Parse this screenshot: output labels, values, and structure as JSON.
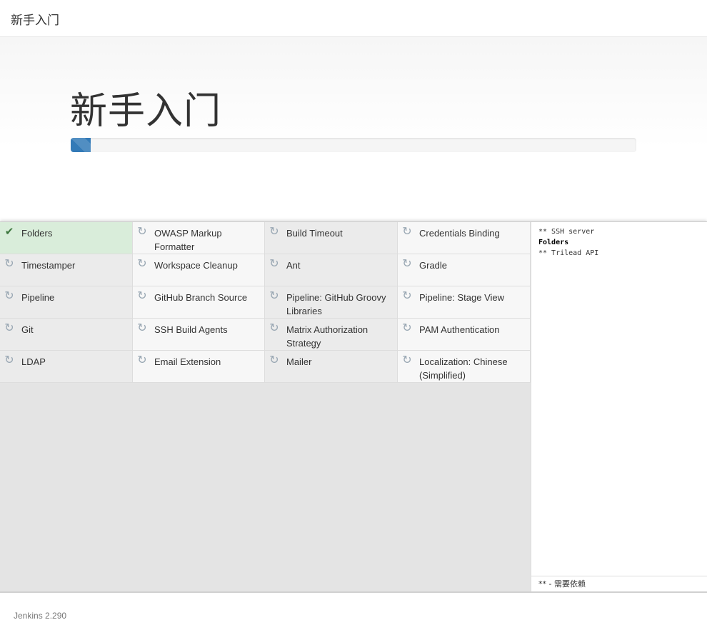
{
  "header": {
    "title": "新手入门"
  },
  "hero": {
    "title": "新手入门",
    "progress_percent": 3.5
  },
  "plugins": [
    {
      "name": "Folders",
      "status": "success"
    },
    {
      "name": "OWASP Markup Formatter",
      "status": "pending"
    },
    {
      "name": "Build Timeout",
      "status": "pending"
    },
    {
      "name": "Credentials Binding",
      "status": "pending"
    },
    {
      "name": "Timestamper",
      "status": "pending"
    },
    {
      "name": "Workspace Cleanup",
      "status": "pending"
    },
    {
      "name": "Ant",
      "status": "pending"
    },
    {
      "name": "Gradle",
      "status": "pending"
    },
    {
      "name": "Pipeline",
      "status": "pending"
    },
    {
      "name": "GitHub Branch Source",
      "status": "pending"
    },
    {
      "name": "Pipeline: GitHub Groovy Libraries",
      "status": "pending"
    },
    {
      "name": "Pipeline: Stage View",
      "status": "pending"
    },
    {
      "name": "Git",
      "status": "pending"
    },
    {
      "name": "SSH Build Agents",
      "status": "pending"
    },
    {
      "name": "Matrix Authorization Strategy",
      "status": "pending"
    },
    {
      "name": "PAM Authentication",
      "status": "pending"
    },
    {
      "name": "LDAP",
      "status": "pending"
    },
    {
      "name": "Email Extension",
      "status": "pending"
    },
    {
      "name": "Mailer",
      "status": "pending"
    },
    {
      "name": "Localization: Chinese (Simplified)",
      "status": "pending"
    }
  ],
  "icons": {
    "success": "check-icon",
    "pending": "refresh-icon"
  },
  "colors": {
    "success_bg": "#d9edda",
    "progress": "#337ab7"
  },
  "log": {
    "lines": [
      {
        "text": "** SSH server",
        "bold": false
      },
      {
        "text": "Folders",
        "bold": true
      },
      {
        "text": "** Trilead API",
        "bold": false
      }
    ],
    "legend": "** - 需要依赖"
  },
  "footer": {
    "version": "Jenkins 2.290"
  }
}
